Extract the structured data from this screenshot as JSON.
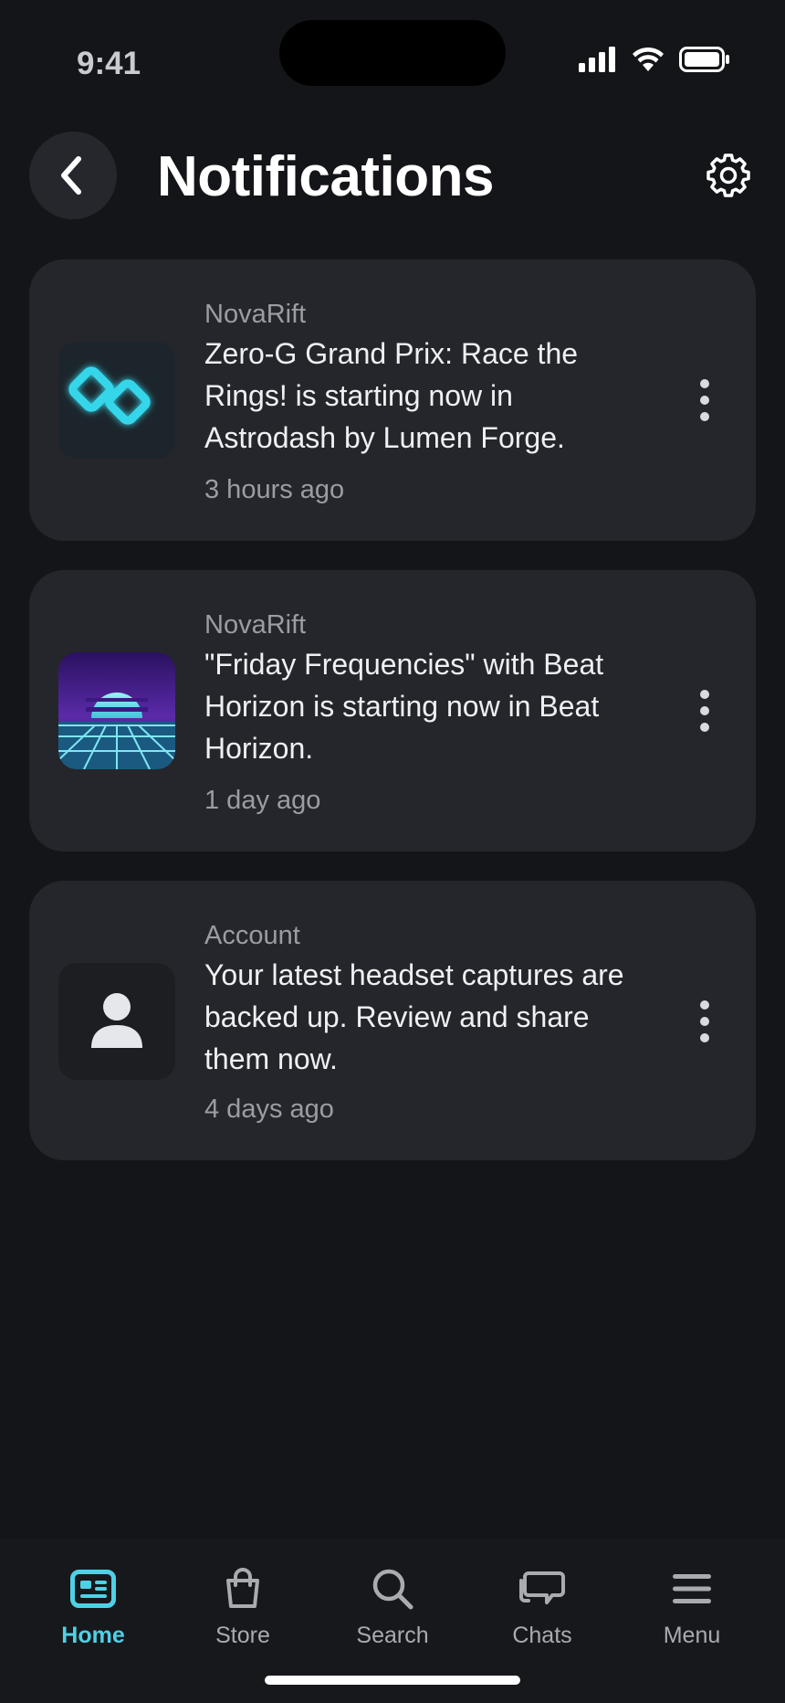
{
  "status_bar": {
    "time": "9:41",
    "icons": [
      "signal-icon",
      "wifi-icon",
      "battery-icon"
    ]
  },
  "header": {
    "title": "Notifications",
    "back_icon": "chevron-left-icon",
    "settings_icon": "gear-icon"
  },
  "notifications": [
    {
      "source": "NovaRift",
      "message": "Zero-G Grand Prix: Race the Rings! is starting now in Astrodash by Lumen Forge.",
      "time": "3 hours ago",
      "thumbnail": "astrodash-rings-icon"
    },
    {
      "source": "NovaRift",
      "message": "\"Friday Frequencies\" with Beat Horizon is starting now in Beat Horizon.",
      "time": "1 day ago",
      "thumbnail": "beat-horizon-synthwave-icon"
    },
    {
      "source": "Account",
      "message": "Your latest headset captures are backed up. Review and share them now.",
      "time": "4 days ago",
      "thumbnail": "person-icon"
    }
  ],
  "bottom_nav": {
    "active": "Home",
    "items": [
      {
        "label": "Home",
        "icon": "home-feed-icon"
      },
      {
        "label": "Store",
        "icon": "shopping-bag-icon"
      },
      {
        "label": "Search",
        "icon": "search-icon"
      },
      {
        "label": "Chats",
        "icon": "chat-bubbles-icon"
      },
      {
        "label": "Menu",
        "icon": "hamburger-menu-icon"
      }
    ]
  },
  "colors": {
    "background": "#141518",
    "card": "#25262b",
    "accent": "#4fd0e6",
    "secondary_text": "#9b9da3"
  }
}
